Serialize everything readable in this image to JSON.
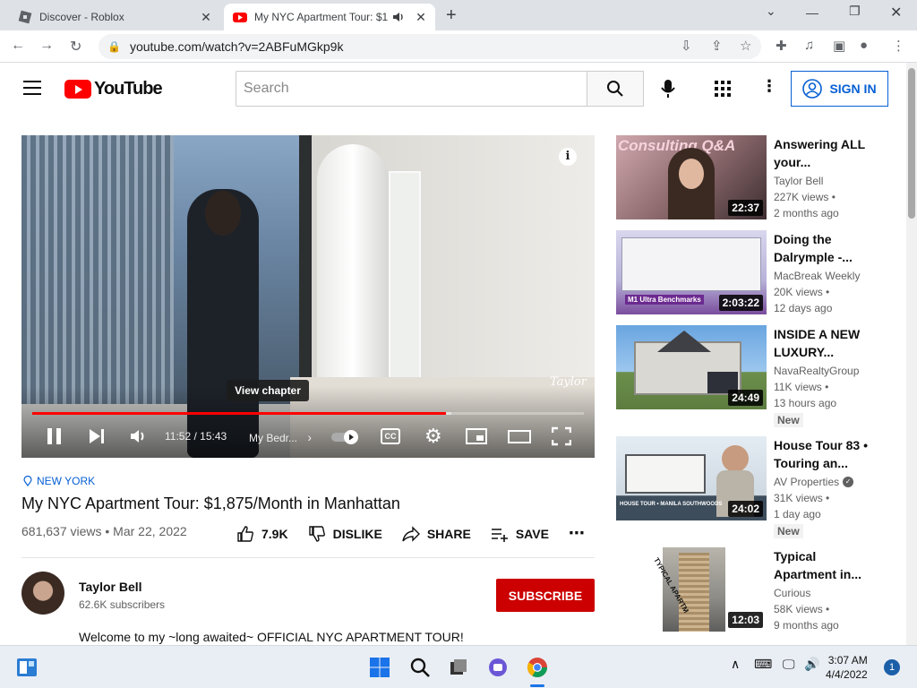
{
  "browser": {
    "tabs": [
      {
        "title": "Discover - Roblox",
        "active": false
      },
      {
        "title": "My NYC Apartment Tour: $1",
        "active": true
      }
    ],
    "url": "youtube.com/watch?v=2ABFuMGkp9k"
  },
  "youtube": {
    "logo_text": "YouTube",
    "search_placeholder": "Search",
    "signin_label": "SIGN IN"
  },
  "player": {
    "chapter_tooltip": "View chapter",
    "time": "11:52 / 15:43",
    "chapter_name": "My Bedr...",
    "progress_played": 0.75,
    "progress_buffered": 0.76,
    "watermark": "Taylor"
  },
  "video": {
    "location": "NEW YORK",
    "title": "My NYC Apartment Tour: $1,875/Month in Manhattan",
    "meta": "681,637 views • Mar 22, 2022",
    "like_count": "7.9K",
    "dislike_label": "DISLIKE",
    "share_label": "SHARE",
    "save_label": "SAVE",
    "channel_name": "Taylor Bell",
    "channel_subs": "62.6K subscribers",
    "subscribe_label": "SUBSCRIBE",
    "description": "Welcome to my ~long awaited~ OFFICIAL NYC APARTMENT TOUR!"
  },
  "recommendations": [
    {
      "title1": "Answering ALL",
      "title2": "your...",
      "channel": "Taylor Bell",
      "views": "227K views •",
      "age": "2 months ago",
      "duration": "22:37",
      "badge": "",
      "thumb_text": "Consulting Q&A"
    },
    {
      "title1": "Doing the",
      "title2": "Dalrymple -...",
      "channel": "MacBreak Weekly",
      "views": "20K views •",
      "age": "12 days ago",
      "duration": "2:03:22",
      "badge": "",
      "thumb_text": "M1 Ultra Benchmarks"
    },
    {
      "title1": "INSIDE A NEW",
      "title2": "LUXURY...",
      "channel": "NavaRealtyGroup",
      "views": "11K views •",
      "age": "13 hours ago",
      "duration": "24:49",
      "badge": "New",
      "thumb_text": ""
    },
    {
      "title1": "House Tour 83 •",
      "title2": "Touring an...",
      "channel": "AV Properties",
      "views": "31K views •",
      "age": "1 day ago",
      "duration": "24:02",
      "badge": "New",
      "thumb_text": "HOUSE TOUR • MANILA SOUTHWOODS"
    },
    {
      "title1": "Typical",
      "title2": "Apartment in...",
      "channel": "Curious",
      "views": "58K views •",
      "age": "9 months ago",
      "duration": "12:03",
      "badge": "",
      "thumb_text": "TYPICAL APARTMENT IN"
    }
  ],
  "taskbar": {
    "time": "3:07 AM",
    "date": "4/4/2022",
    "notifications": "1"
  },
  "colors": {
    "youtube_red": "#ff0000",
    "subscribe_red": "#cc0000",
    "link_blue": "#065fd4"
  }
}
